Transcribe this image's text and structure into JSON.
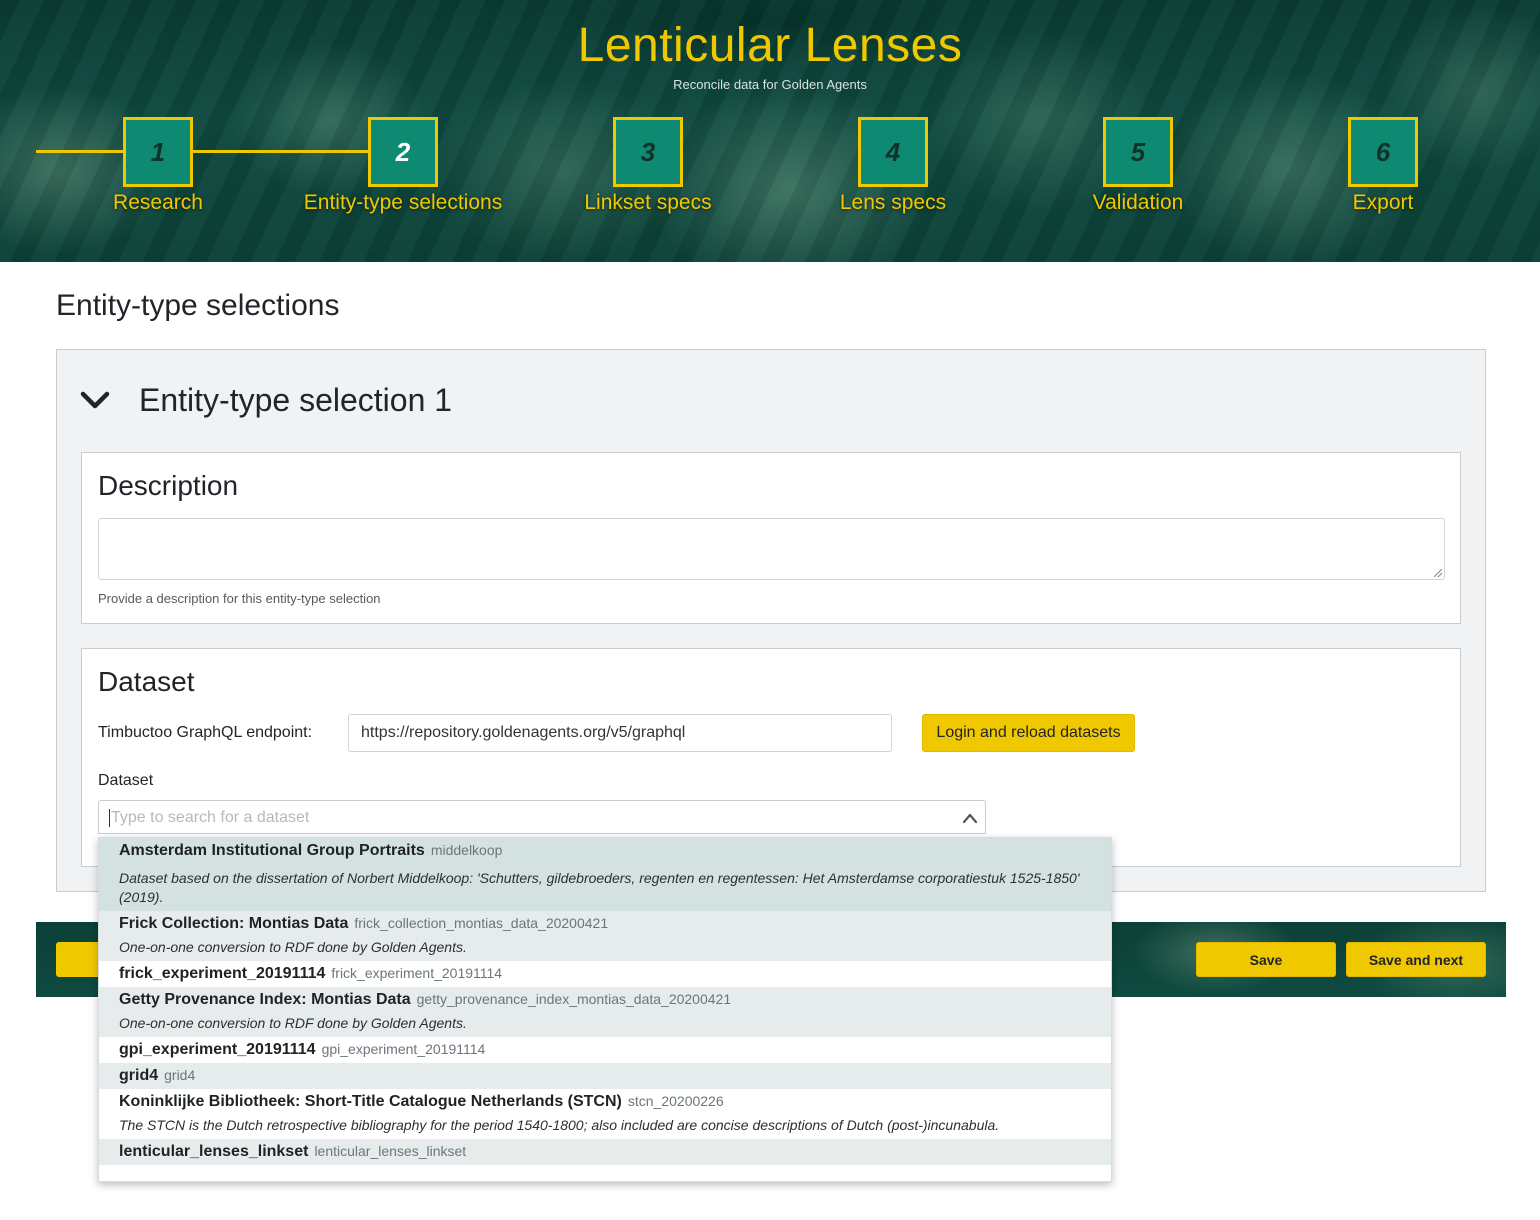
{
  "header": {
    "title": "Lenticular Lenses",
    "subtitle": "Reconcile data for Golden Agents",
    "steps": [
      {
        "number": "1",
        "label": "Research"
      },
      {
        "number": "2",
        "label": "Entity-type selections"
      },
      {
        "number": "3",
        "label": "Linkset specs"
      },
      {
        "number": "4",
        "label": "Lens specs"
      },
      {
        "number": "5",
        "label": "Validation"
      },
      {
        "number": "6",
        "label": "Export"
      }
    ],
    "active_step": 2
  },
  "main": {
    "page_title": "Entity-type selections",
    "selection_title": "Entity-type selection 1",
    "description": {
      "heading": "Description",
      "value": "",
      "help": "Provide a description for this entity-type selection"
    },
    "dataset": {
      "heading": "Dataset",
      "endpoint_label": "Timbuctoo GraphQL endpoint:",
      "endpoint_value": "https://repository.goldenagents.org/v5/graphql",
      "login_button": "Login and reload datasets",
      "dataset_label": "Dataset",
      "search_placeholder": "Type to search for a dataset",
      "options": [
        {
          "title": "Amsterdam Institutional Group Portraits",
          "id": "middelkoop",
          "description": "Dataset based on the dissertation of Norbert Middelkoop: 'Schutters, gildebroeders, regenten en regentessen: Het Amsterdamse corporatiestuk 1525-1850' (2019)."
        },
        {
          "title": "Frick Collection: Montias Data",
          "id": "frick_collection_montias_data_20200421",
          "description": "One-on-one conversion to RDF done by Golden Agents."
        },
        {
          "title": "frick_experiment_20191114",
          "id": "frick_experiment_20191114",
          "description": ""
        },
        {
          "title": "Getty Provenance Index: Montias Data",
          "id": "getty_provenance_index_montias_data_20200421",
          "description": "One-on-one conversion to RDF done by Golden Agents."
        },
        {
          "title": "gpi_experiment_20191114",
          "id": "gpi_experiment_20191114",
          "description": ""
        },
        {
          "title": "grid4",
          "id": "grid4",
          "description": ""
        },
        {
          "title": "Koninklijke Bibliotheek: Short-Title Catalogue Netherlands (STCN)",
          "id": "stcn_20200226",
          "description": "The STCN is the Dutch retrospective bibliography for the period 1540-1800; also included are concise descriptions of Dutch (post-)incunabula."
        },
        {
          "title": "lenticular_lenses_linkset",
          "id": "lenticular_lenses_linkset",
          "description": ""
        }
      ]
    }
  },
  "footer": {
    "save": "Save",
    "save_next": "Save and next"
  },
  "colors": {
    "accent": "#f0c800",
    "step_box": "#0f8a72",
    "banner": "#0f4a40"
  },
  "icons": {
    "collapse": "chevron-down-icon",
    "dropdown": "chevron-up-icon"
  }
}
